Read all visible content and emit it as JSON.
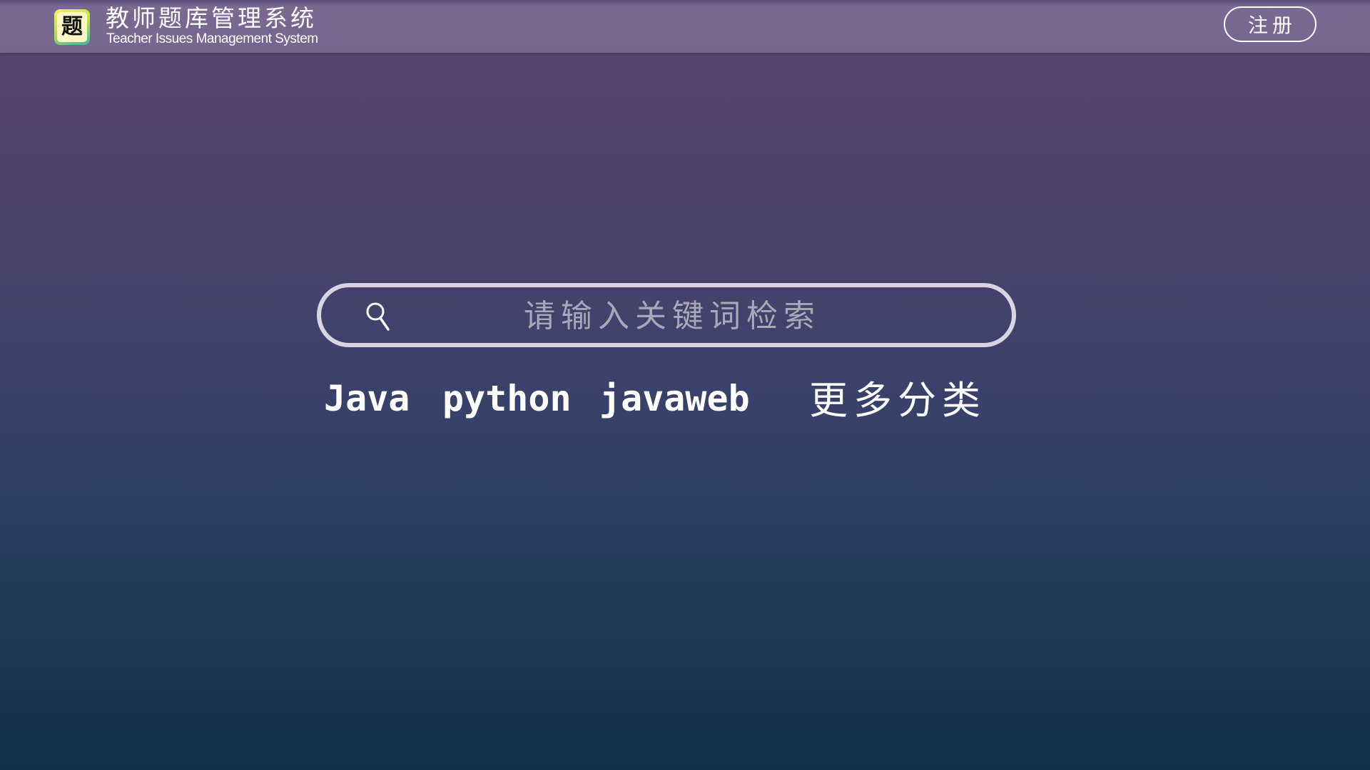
{
  "header": {
    "logo_char": "题",
    "title_cn": "教师题库管理系统",
    "title_en": "Teacher Issues Management System",
    "register_label": "注册"
  },
  "search": {
    "placeholder": "请输入关键词检索",
    "value": "",
    "icon": "search-icon"
  },
  "quick_links": [
    {
      "label": "Java"
    },
    {
      "label": "python"
    },
    {
      "label": "javaweb"
    }
  ],
  "more_categories_label": "更多分类",
  "colors": {
    "topbar": "#76658e",
    "background_top": "#5a4672",
    "background_bottom": "#0e3049",
    "search_border": "#d8d4e2",
    "placeholder": "#a9a7b8",
    "text": "#ffffff"
  }
}
